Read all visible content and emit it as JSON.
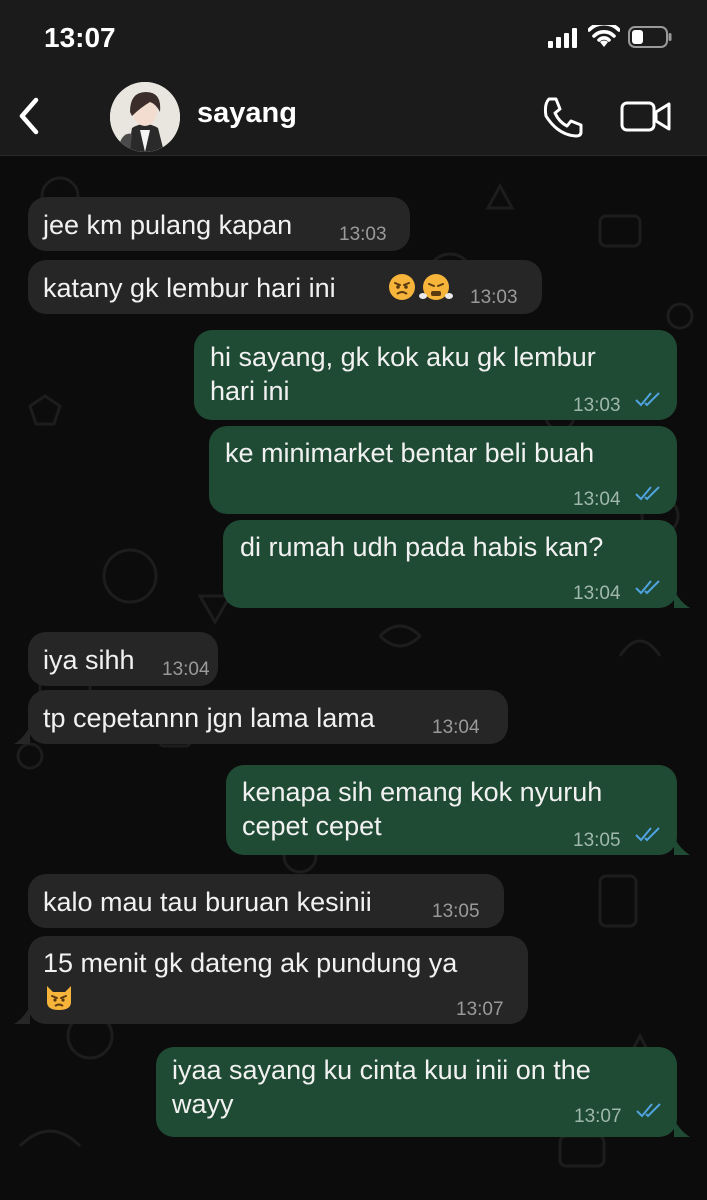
{
  "status": {
    "time": "13:07"
  },
  "header": {
    "contact_name": "sayang"
  },
  "messages": [
    {
      "dir": "in",
      "text": "jee km pulang kapan",
      "time": "13:03"
    },
    {
      "dir": "in",
      "text": "katany gk lembur hari ini",
      "emoji": [
        "angry-face",
        "face-with-steam"
      ],
      "time": "13:03"
    },
    {
      "dir": "out",
      "text_lines": [
        "hi sayang, gk kok aku gk lembur",
        "hari ini"
      ],
      "time": "13:03",
      "read": true
    },
    {
      "dir": "out",
      "text": "ke minimarket bentar beli buah",
      "time": "13:04",
      "read": true
    },
    {
      "dir": "out",
      "text": "di rumah udh pada habis kan?",
      "time": "13:04",
      "read": true
    },
    {
      "dir": "in",
      "text": "iya sihh",
      "time": "13:04"
    },
    {
      "dir": "in",
      "text": "tp cepetannn jgn lama lama",
      "time": "13:04"
    },
    {
      "dir": "out",
      "text_lines": [
        "kenapa sih emang kok nyuruh",
        "cepet cepet"
      ],
      "time": "13:05",
      "read": true
    },
    {
      "dir": "in",
      "text": "kalo mau tau buruan kesinii",
      "time": "13:05"
    },
    {
      "dir": "in",
      "text": "15 menit gk dateng ak pundung ya",
      "emoji": [
        "pouting-cat"
      ],
      "time": "13:07"
    },
    {
      "dir": "out",
      "text_lines": [
        "iyaa sayang ku cinta kuu inii on the",
        "wayy"
      ],
      "time": "13:07",
      "read": true
    }
  ],
  "colors": {
    "incoming_bubble": "#262626",
    "outgoing_bubble": "#1f4a33",
    "read_ticks": "#4fa3e0"
  }
}
